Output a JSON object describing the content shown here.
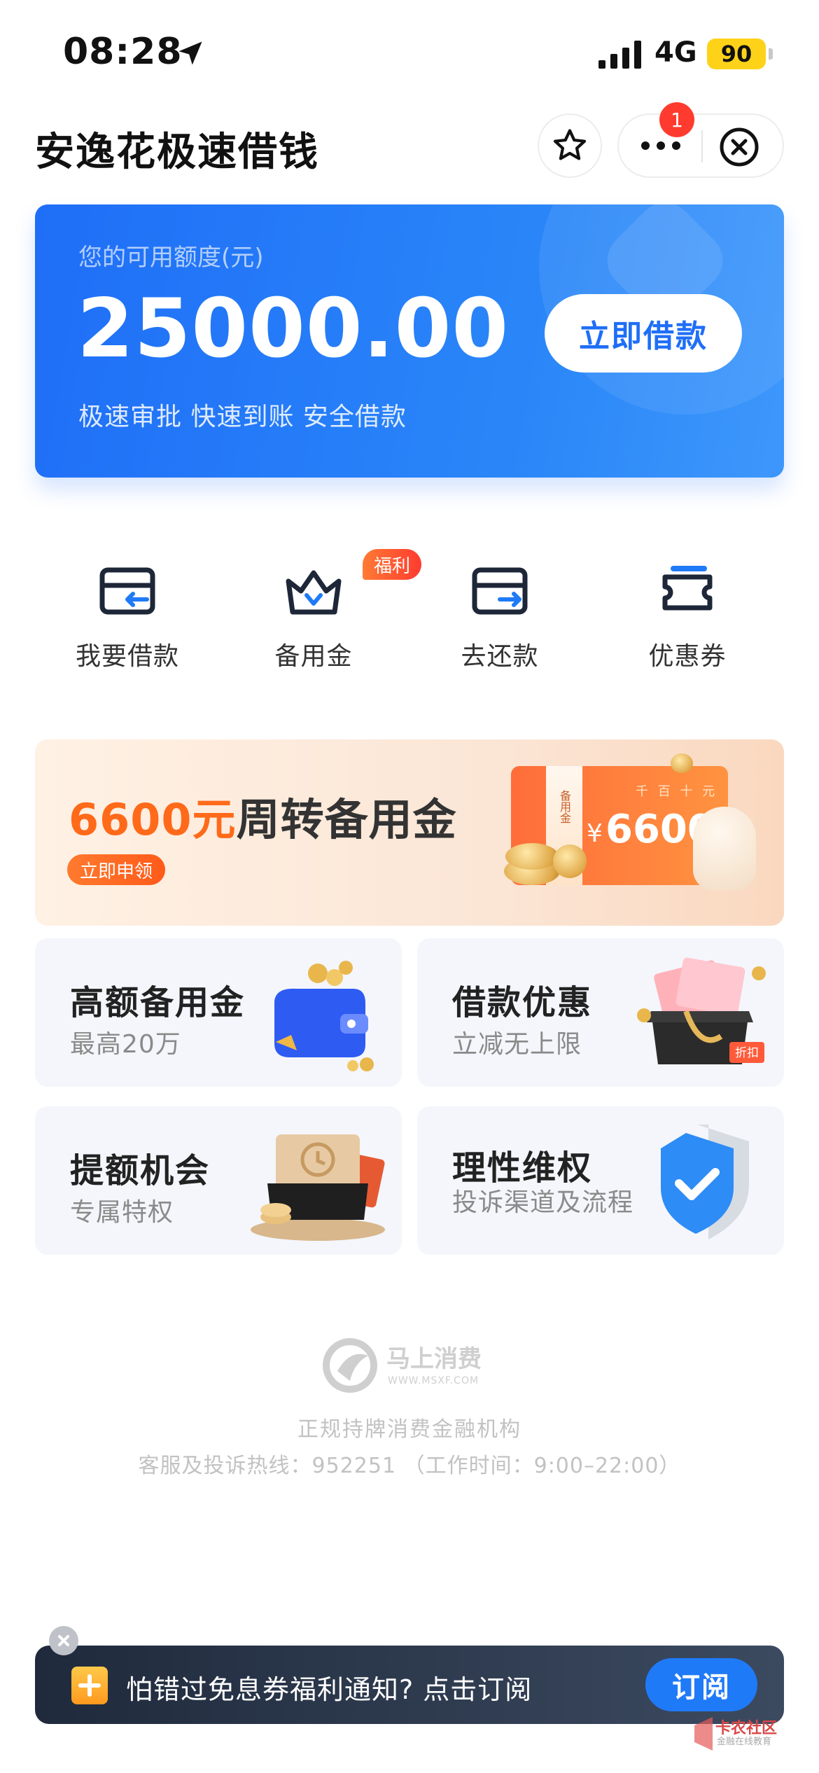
{
  "status_bar": {
    "time": "08:28",
    "network": "4G",
    "battery": "90",
    "icons": [
      "location-arrow-icon",
      "signal-bars-icon"
    ]
  },
  "header": {
    "title": "安逸花极速借钱",
    "notification_count": "1",
    "icons": [
      "star-icon",
      "more-dots-icon",
      "close-circle-icon"
    ]
  },
  "credit": {
    "label": "您的可用额度(元)",
    "amount": "25000.00",
    "tagline": "极速审批 快速到账 安全借款",
    "cta": "立即借款"
  },
  "quick_actions": [
    {
      "label": "我要借款",
      "icon": "wallet-in-icon"
    },
    {
      "label": "备用金",
      "icon": "crown-icon",
      "badge": "福利"
    },
    {
      "label": "去还款",
      "icon": "wallet-out-icon"
    },
    {
      "label": "优惠券",
      "icon": "ticket-icon"
    }
  ],
  "banner": {
    "amount": "6600元",
    "title": "周转备用金",
    "cta": "立即申领",
    "box_amount": "6600",
    "box_currency": "¥",
    "box_units": "千 百 十 元",
    "box_tag": "备用金"
  },
  "features": [
    {
      "title": "高额备用金",
      "subtitle": "最高20万",
      "icon": "purse-coins-icon"
    },
    {
      "title": "借款优惠",
      "subtitle": "立减无上限",
      "icon": "gift-box-icon",
      "tag": "折扣"
    },
    {
      "title": "提额机会",
      "subtitle": "专属特权",
      "icon": "envelope-clock-icon"
    },
    {
      "title": "理性维权",
      "subtitle": "投诉渠道及流程",
      "icon": "shield-check-icon"
    }
  ],
  "footer": {
    "brand": "马上消费",
    "brand_url": "WWW.MSXF.COM",
    "license": "正规持牌消费金融机构",
    "hotline": "客服及投诉热线：952251 （工作时间：9:00–22:00）"
  },
  "subscribe": {
    "text": "怕错过免息券福利通知? 点击订阅",
    "button": "订阅"
  },
  "watermark": {
    "text": "卡农社区",
    "sub": "金融在线教育"
  },
  "colors": {
    "primary": "#1f6ef7",
    "accent_orange": "#ff6a1a",
    "badge_red": "#ff3b2f",
    "battery_yellow": "#ffd21a"
  }
}
